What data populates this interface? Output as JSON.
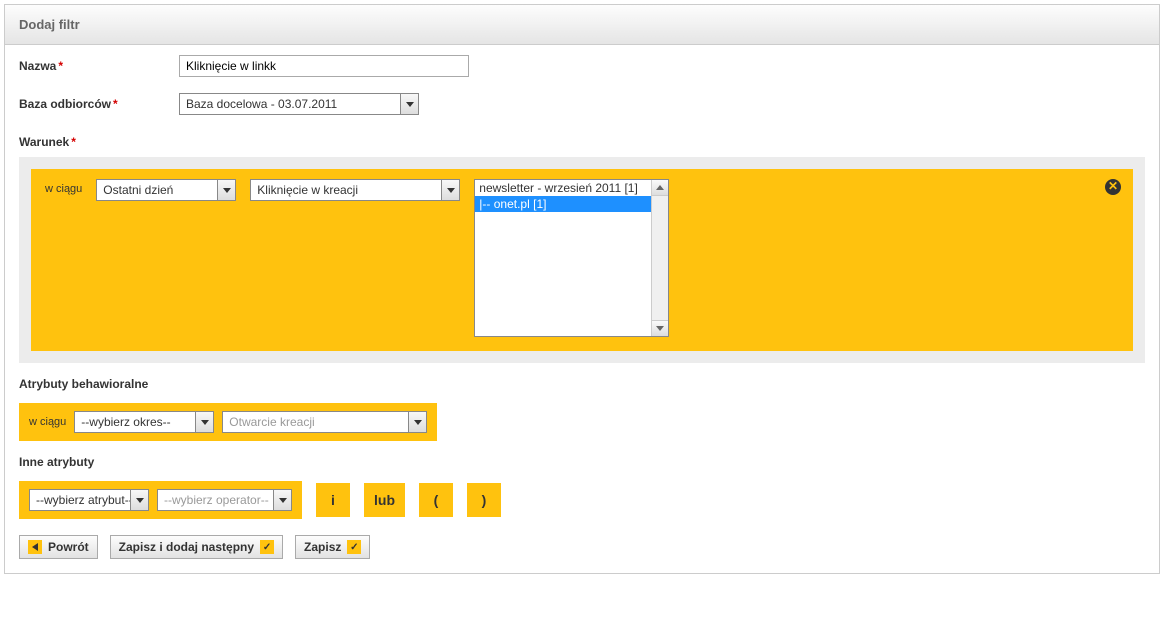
{
  "header": {
    "title": "Dodaj filtr"
  },
  "fields": {
    "name_label": "Nazwa",
    "name_value": "Kliknięcie w linkk",
    "base_label": "Baza odbiorców",
    "base_value": "Baza docelowa - 03.07.2011",
    "condition_label": "Warunek"
  },
  "condition": {
    "in_label": "w ciągu",
    "period_value": "Ostatni dzień",
    "action_value": "Kliknięcie w kreacji",
    "list_items": [
      "newsletter - wrzesień 2011 [1]",
      "|-- onet.pl [1]"
    ],
    "selected_index": 1
  },
  "behavioral": {
    "title": "Atrybuty behawioralne",
    "in_label": "w ciągu",
    "period_placeholder": "--wybierz okres--",
    "action_placeholder": "Otwarcie kreacji"
  },
  "other": {
    "title": "Inne atrybuty",
    "attr_placeholder": "--wybierz atrybut--",
    "op_placeholder": "--wybierz operator--",
    "ops": {
      "and": "i",
      "or": "lub",
      "open": "(",
      "close": ")"
    }
  },
  "footer": {
    "back": "Powrót",
    "save_next": "Zapisz i dodaj następny",
    "save": "Zapisz"
  }
}
